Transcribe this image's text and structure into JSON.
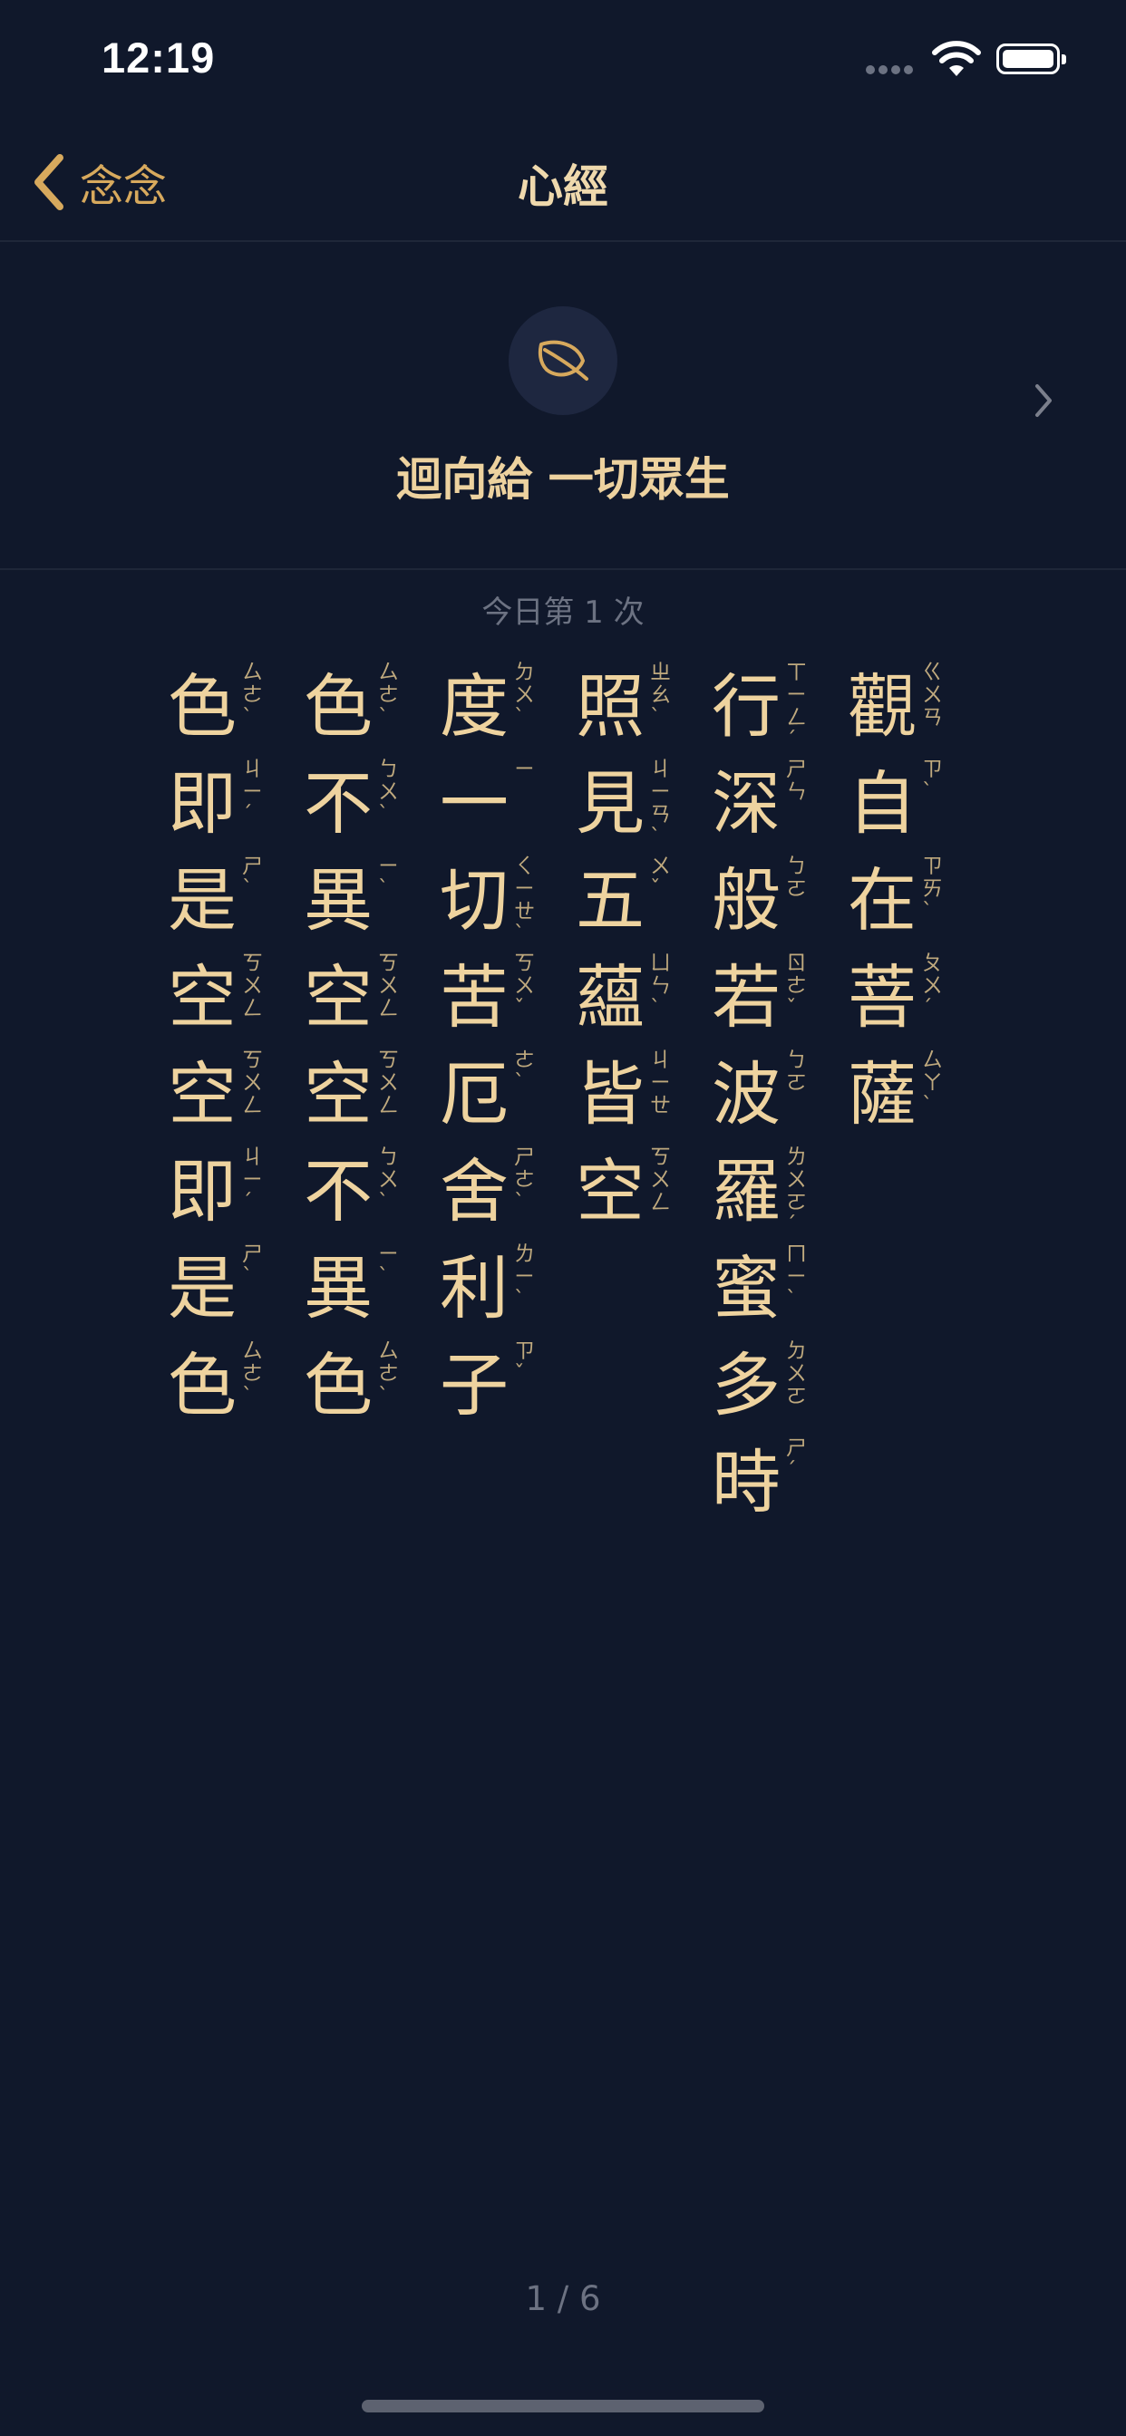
{
  "status_bar": {
    "time": "12:19"
  },
  "nav": {
    "back_label": "念念",
    "title": "心經"
  },
  "dedication": {
    "icon": "leaf-icon",
    "text": "迴向給 一切眾生"
  },
  "today_count": "今日第 1 次",
  "sutra_columns": [
    [
      [
        "觀",
        "ㄍㄨㄢ"
      ],
      [
        "自",
        "ㄗˋ"
      ],
      [
        "在",
        "ㄗㄞˋ"
      ],
      [
        "菩",
        "ㄆㄨˊ"
      ],
      [
        "薩",
        "ㄙㄚˋ"
      ]
    ],
    [
      [
        "行",
        "ㄒㄧㄥˊ"
      ],
      [
        "深",
        "ㄕㄣ"
      ],
      [
        "般",
        "ㄅㄛ"
      ],
      [
        "若",
        "ㄖㄜˇ"
      ],
      [
        "波",
        "ㄅㄛ"
      ],
      [
        "羅",
        "ㄌㄨㄛˊ"
      ],
      [
        "蜜",
        "ㄇㄧˋ"
      ],
      [
        "多",
        "ㄉㄨㄛ"
      ],
      [
        "時",
        "ㄕˊ"
      ]
    ],
    [
      [
        "照",
        "ㄓㄠˋ"
      ],
      [
        "見",
        "ㄐㄧㄢˋ"
      ],
      [
        "五",
        "ㄨˇ"
      ],
      [
        "蘊",
        "ㄩㄣˋ"
      ],
      [
        "皆",
        "ㄐㄧㄝ"
      ],
      [
        "空",
        "ㄎㄨㄥ"
      ]
    ],
    [
      [
        "度",
        "ㄉㄨˋ"
      ],
      [
        "一",
        "ㄧ"
      ],
      [
        "切",
        "ㄑㄧㄝˋ"
      ],
      [
        "苦",
        "ㄎㄨˇ"
      ],
      [
        "厄",
        "ㄜˋ"
      ],
      [
        "舍",
        "ㄕㄜˋ"
      ],
      [
        "利",
        "ㄌㄧˋ"
      ],
      [
        "子",
        "ㄗˇ"
      ]
    ],
    [
      [
        "色",
        "ㄙㄜˋ"
      ],
      [
        "不",
        "ㄅㄨˋ"
      ],
      [
        "異",
        "ㄧˋ"
      ],
      [
        "空",
        "ㄎㄨㄥ"
      ],
      [
        "空",
        "ㄎㄨㄥ"
      ],
      [
        "不",
        "ㄅㄨˋ"
      ],
      [
        "異",
        "ㄧˋ"
      ],
      [
        "色",
        "ㄙㄜˋ"
      ]
    ],
    [
      [
        "色",
        "ㄙㄜˋ"
      ],
      [
        "即",
        "ㄐㄧˊ"
      ],
      [
        "是",
        "ㄕˋ"
      ],
      [
        "空",
        "ㄎㄨㄥ"
      ],
      [
        "空",
        "ㄎㄨㄥ"
      ],
      [
        "即",
        "ㄐㄧˊ"
      ],
      [
        "是",
        "ㄕˋ"
      ],
      [
        "色",
        "ㄙㄜˋ"
      ]
    ]
  ],
  "page_indicator": "1 / 6",
  "colors": {
    "background": "#10182b",
    "accent": "#d7a95d",
    "text": "#eed39f",
    "muted": "#6c7282"
  }
}
